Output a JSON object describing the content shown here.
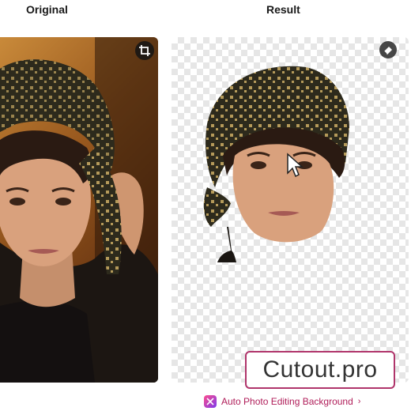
{
  "labels": {
    "original": "Original",
    "result": "Result"
  },
  "controls": {
    "crop_icon": "crop-icon",
    "eraser_icon": "eraser-icon"
  },
  "brand": {
    "text": "Cutout.pro"
  },
  "link": {
    "text": "Auto Photo Editing Background",
    "chevron": "›",
    "icon": "magic-app-icon"
  },
  "colors": {
    "brand_border": "#b0356b",
    "link_text": "#b01e5a"
  }
}
